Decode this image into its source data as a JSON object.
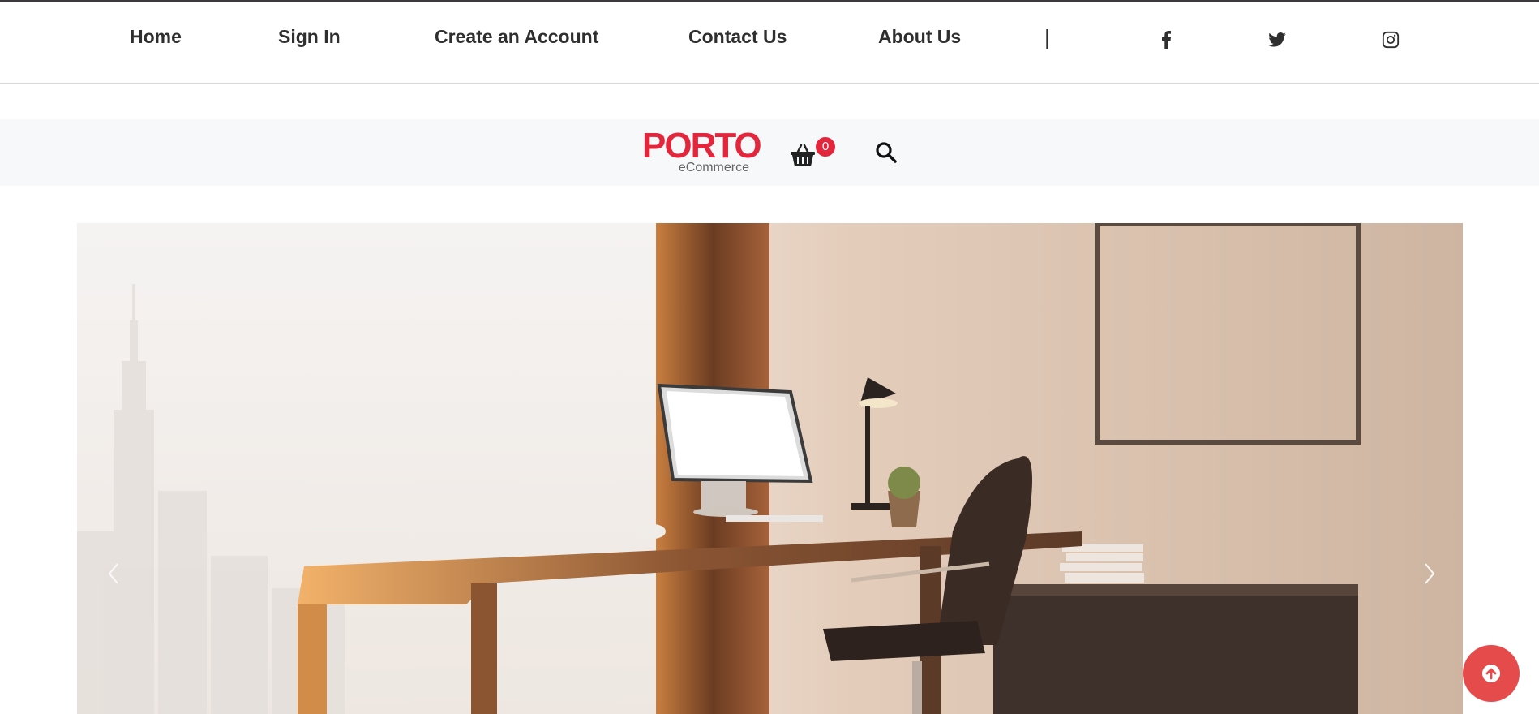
{
  "nav": {
    "links": [
      "Home",
      "Sign In",
      "Create an Account",
      "Contact Us",
      "About Us"
    ],
    "separator": "|",
    "social": [
      "facebook-icon",
      "twitter-icon",
      "instagram-icon"
    ]
  },
  "header": {
    "logo_text": "PORTO",
    "logo_sub": "eCommerce",
    "cart_count": "0",
    "cart_icon": "basket-icon",
    "search_icon": "search-icon"
  },
  "hero": {
    "prev_icon": "chevron-left-icon",
    "next_icon": "chevron-right-icon"
  },
  "back_to_top_icon": "arrow-up-circle-icon",
  "colors": {
    "brand": "#e4263d",
    "back_to_top": "#e54b4b",
    "text": "#2f2f2f"
  }
}
